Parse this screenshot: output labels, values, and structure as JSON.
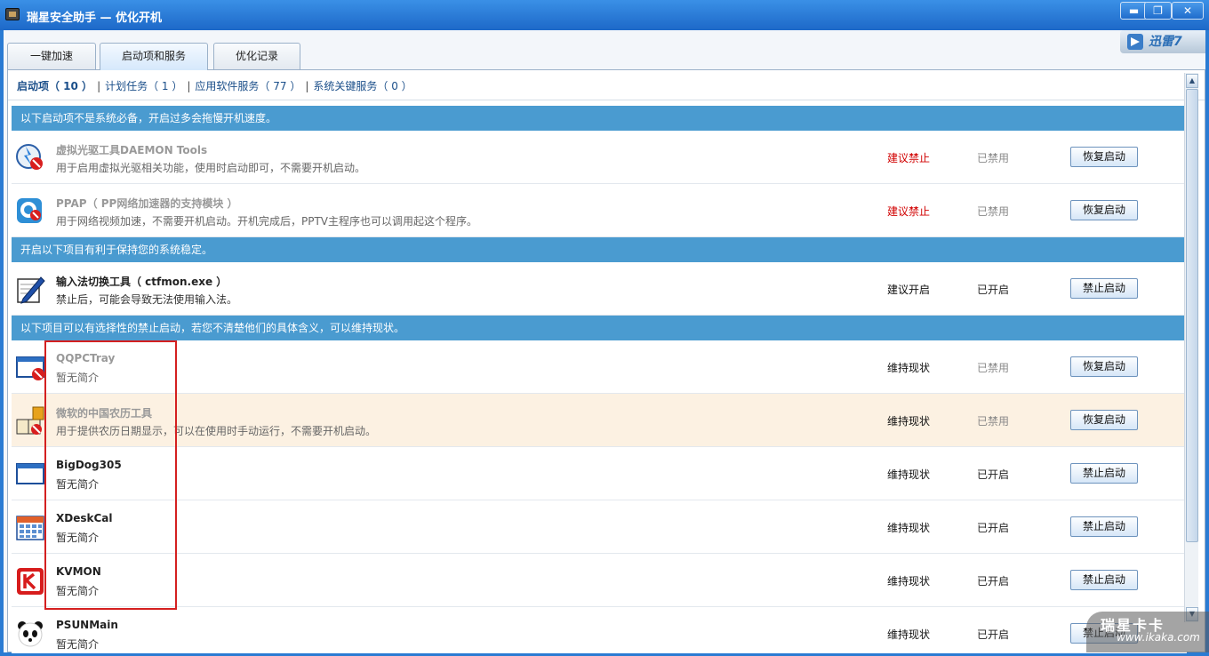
{
  "window": {
    "title": "瑞星安全助手 — 优化开机",
    "controls": {
      "minimize": "▬",
      "maximize": "❐",
      "close": "✕"
    }
  },
  "tabs": [
    {
      "label": "一键加速",
      "active": false
    },
    {
      "label": "启动项和服务",
      "active": true
    },
    {
      "label": "优化记录",
      "active": false
    }
  ],
  "promo": {
    "label": "迅雷7"
  },
  "subnav": {
    "items": [
      {
        "label": "启动项（ 10 ）",
        "active": true
      },
      {
        "label": "计划任务（ 1 ）",
        "active": false
      },
      {
        "label": "应用软件服务（ 77 ）",
        "active": false
      },
      {
        "label": "系统关键服务（ 0 ）",
        "active": false
      }
    ],
    "separator": "|"
  },
  "sections": [
    {
      "header": "以下启动项不是系统必备，开启过多会拖慢开机速度。",
      "rows": [
        {
          "icon": "daemon-tools-icon",
          "name": "虚拟光驱工具DAEMON Tools",
          "desc": "用于启用虚拟光驱相关功能，使用时启动即可，不需要开机启动。",
          "advice": "建议禁止",
          "advice_red": true,
          "state": "已禁用",
          "state_gray": true,
          "button": "恢复启动",
          "disabled": true,
          "highlight": false
        },
        {
          "icon": "pptv-icon",
          "name": "PPAP（ PP网络加速器的支持模块 ）",
          "desc": "用于网络视频加速，不需要开机启动。开机完成后，PPTV主程序也可以调用起这个程序。",
          "advice": "建议禁止",
          "advice_red": true,
          "state": "已禁用",
          "state_gray": true,
          "button": "恢复启动",
          "disabled": true,
          "highlight": false
        }
      ]
    },
    {
      "header": "开启以下项目有利于保持您的系统稳定。",
      "rows": [
        {
          "icon": "ime-pen-icon",
          "name": "输入法切换工具（ ctfmon.exe ）",
          "desc": "禁止后，可能会导致无法使用输入法。",
          "advice": "建议开启",
          "advice_red": false,
          "state": "已开启",
          "state_gray": false,
          "button": "禁止启动",
          "disabled": false,
          "highlight": false
        }
      ]
    },
    {
      "header": "以下项目可以有选择性的禁止启动，若您不清楚他们的具体含义，可以维持现状。",
      "rows": [
        {
          "icon": "window-disabled-icon",
          "name": "QQPCTray",
          "desc": "暂无简介",
          "advice": "维持现状",
          "advice_red": false,
          "state": "已禁用",
          "state_gray": true,
          "button": "恢复启动",
          "disabled": true,
          "highlight": false
        },
        {
          "icon": "calendar-book-icon",
          "name": "微软的中国农历工具",
          "desc": "用于提供农历日期显示，可以在使用时手动运行，不需要开机启动。",
          "advice": "维持现状",
          "advice_red": false,
          "state": "已禁用",
          "state_gray": true,
          "button": "恢复启动",
          "disabled": true,
          "highlight": true
        },
        {
          "icon": "window-icon",
          "name": "BigDog305",
          "desc": "暂无简介",
          "advice": "维持现状",
          "advice_red": false,
          "state": "已开启",
          "state_gray": false,
          "button": "禁止启动",
          "disabled": false,
          "highlight": false
        },
        {
          "icon": "calendar-icon",
          "name": "XDeskCal",
          "desc": "暂无简介",
          "advice": "维持现状",
          "advice_red": false,
          "state": "已开启",
          "state_gray": false,
          "button": "禁止启动",
          "disabled": false,
          "highlight": false
        },
        {
          "icon": "kaspersky-k-icon",
          "name": "KVMON",
          "desc": "暂无简介",
          "advice": "维持现状",
          "advice_red": false,
          "state": "已开启",
          "state_gray": false,
          "button": "禁止启动",
          "disabled": false,
          "highlight": false
        },
        {
          "icon": "panda-icon",
          "name": "PSUNMain",
          "desc": "暂无简介",
          "advice": "维持现状",
          "advice_red": false,
          "state": "已开启",
          "state_gray": false,
          "button": "禁止启动",
          "disabled": false,
          "highlight": false
        }
      ]
    }
  ],
  "watermark": {
    "brand": "瑞星卡卡",
    "url": "www.ikaka.com"
  },
  "colors": {
    "section_header": "#4a9bd0",
    "titlebar": "#1d68c8",
    "advice_red": "#d10000",
    "highlight_row": "#fcf1e2",
    "annotation_box": "#d42020"
  }
}
